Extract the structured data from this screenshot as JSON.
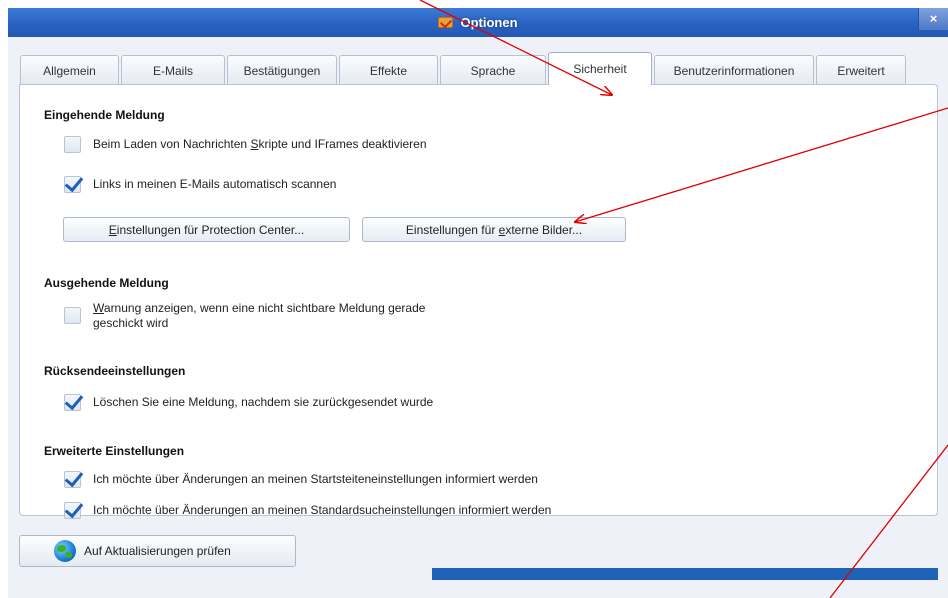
{
  "window": {
    "title": "Optionen",
    "close_label": "×"
  },
  "tabs": [
    {
      "label": "Allgemein",
      "active": false
    },
    {
      "label": "E-Mails",
      "active": false
    },
    {
      "label": "Bestätigungen",
      "active": false
    },
    {
      "label": "Effekte",
      "active": false
    },
    {
      "label": "Sprache",
      "active": false
    },
    {
      "label": "Sicherheit",
      "active": true
    },
    {
      "label": "Benutzerinformationen",
      "active": false
    },
    {
      "label": "Erweitert",
      "active": false
    }
  ],
  "incoming": {
    "title": "Eingehende Meldung",
    "disable_scripts": {
      "pre": "Beim Laden von Nachrichten ",
      "accel": "S",
      "post": "kripte und IFrames deaktivieren",
      "checked": false
    },
    "scan_links": {
      "label": "Links in meinen E-Mails automatisch scannen",
      "checked": true
    },
    "protection_button": {
      "accel": "E",
      "rest": "instellungen für Protection Center..."
    },
    "images_button": {
      "pre": "Einstellungen für ",
      "accel": "e",
      "post": "xterne Bilder..."
    }
  },
  "outgoing": {
    "title": "Ausgehende Meldung",
    "warn": {
      "accel": "W",
      "line1": "arnung anzeigen, wenn eine nicht sichtbare Meldung gerade",
      "line2": "geschickt wird",
      "checked": false
    }
  },
  "resend": {
    "title": "Rücksendeeinstellungen",
    "delete": {
      "label": "Löschen Sie eine Meldung, nachdem sie zurückgesendet wurde",
      "checked": true
    }
  },
  "advanced": {
    "title": "Erweiterte Einstellungen",
    "startpage": {
      "label": "Ich möchte über Änderungen an meinen Startsteiteneinstellungen informiert werden",
      "checked": true
    },
    "searchsettings": {
      "label": "Ich möchte über Änderungen an meinen Standardsucheinstellungen informiert werden",
      "checked": true
    }
  },
  "footer": {
    "update_button": "Auf Aktualisierungen prüfen"
  },
  "colors": {
    "titlebar": "#2a62c2",
    "annotation": "#e00000",
    "check": "#1f5fb8"
  }
}
